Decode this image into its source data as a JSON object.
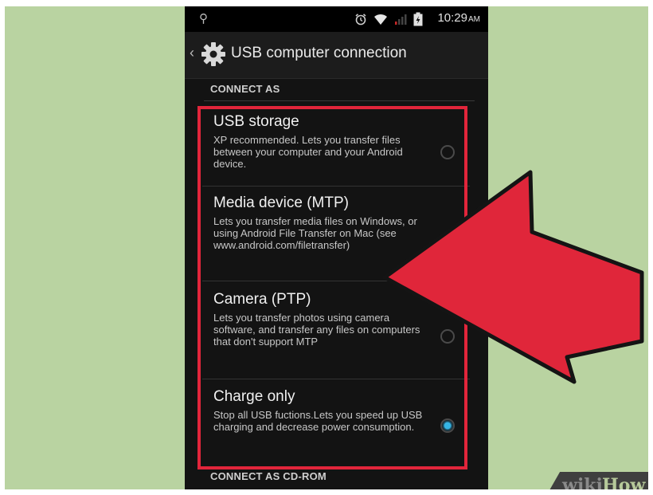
{
  "status_bar": {
    "time": "10:29",
    "ampm": "AM",
    "icons": [
      "usb-icon",
      "alarm-icon",
      "wifi-icon",
      "signal-icon",
      "battery-icon"
    ]
  },
  "action_bar": {
    "title": "USB computer connection",
    "icon": "gear-icon"
  },
  "sections": {
    "connect_as": "CONNECT AS",
    "connect_as_cdrom": "CONNECT AS CD-ROM"
  },
  "options": [
    {
      "title": "USB storage",
      "desc": "XP recommended. Lets you transfer files between your computer and your Android device.",
      "checked": false
    },
    {
      "title": "Media device (MTP)",
      "desc": "Lets you transfer media files on Windows, or using Android File Transfer on Mac (see www.android.com/filetransfer)",
      "checked": false
    },
    {
      "title": "Camera (PTP)",
      "desc": "Lets you transfer photos using camera software, and transfer any files on computers that don't support MTP",
      "checked": false
    },
    {
      "title": "Charge only",
      "desc": "Stop all USB fuctions.Lets you speed up USB charging and decrease power consumption.",
      "checked": true
    }
  ],
  "watermark": {
    "wiki": "wiki",
    "how": "How"
  },
  "colors": {
    "background": "#b9d3a1",
    "highlight": "#e2253b",
    "radio_selected": "#35b5e5",
    "arrow_fill": "#e0263a"
  }
}
